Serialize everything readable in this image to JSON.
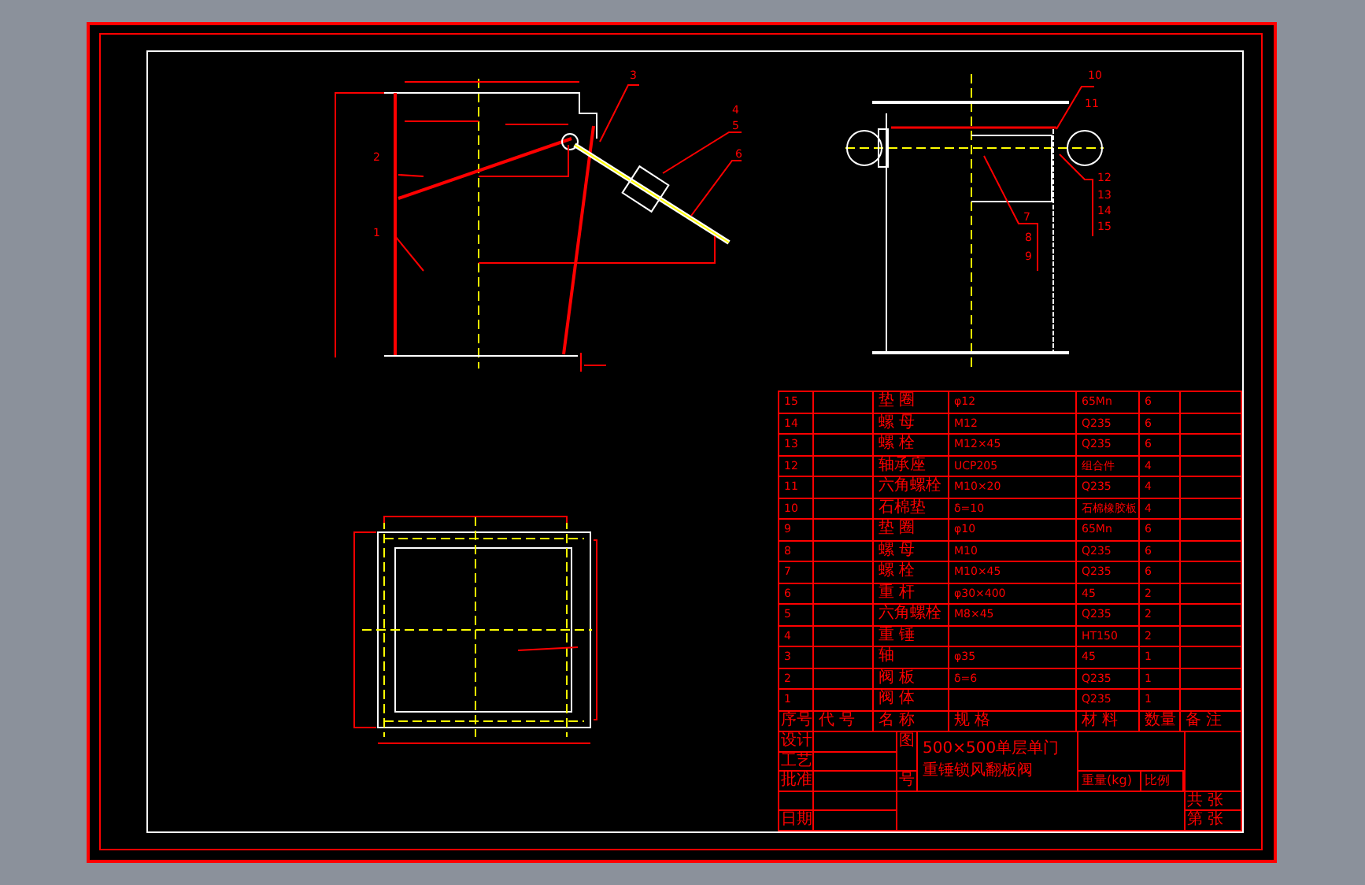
{
  "front_view": {
    "callouts": [
      "1",
      "2",
      "3",
      "4",
      "5",
      "6"
    ]
  },
  "side_view": {
    "callouts": [
      "10",
      "11",
      "12",
      "13",
      "14",
      "15",
      "7",
      "8",
      "9"
    ]
  },
  "parts_table": {
    "columns": [
      "序号",
      "代 号",
      "名 称",
      "规 格",
      "材 料",
      "数量",
      "备 注"
    ],
    "rows": [
      {
        "no": "15",
        "name": "垫 圈",
        "spec": "φ12",
        "material": "65Mn",
        "qty": "6"
      },
      {
        "no": "14",
        "name": "螺 母",
        "spec": "M12",
        "material": "Q235",
        "qty": "6"
      },
      {
        "no": "13",
        "name": "螺 栓",
        "spec": "M12×45",
        "material": "Q235",
        "qty": "6"
      },
      {
        "no": "12",
        "name": "轴承座",
        "spec": "UCP205",
        "material": "组合件",
        "qty": "4"
      },
      {
        "no": "11",
        "name": "六角螺栓",
        "spec": "M10×20",
        "material": "Q235",
        "qty": "4"
      },
      {
        "no": "10",
        "name": "石棉垫",
        "spec": "δ=10",
        "material": "石棉橡胶板",
        "qty": "4"
      },
      {
        "no": "9",
        "name": "垫 圈",
        "spec": "φ10",
        "material": "65Mn",
        "qty": "6"
      },
      {
        "no": "8",
        "name": "螺 母",
        "spec": "M10",
        "material": "Q235",
        "qty": "6"
      },
      {
        "no": "7",
        "name": "螺 栓",
        "spec": "M10×45",
        "material": "Q235",
        "qty": "6"
      },
      {
        "no": "6",
        "name": "重 杆",
        "spec": "φ30×400",
        "material": "45",
        "qty": "2"
      },
      {
        "no": "5",
        "name": "六角螺栓",
        "spec": "M8×45",
        "material": "Q235",
        "qty": "2"
      },
      {
        "no": "4",
        "name": "重 锤",
        "spec": "",
        "material": "HT150",
        "qty": "2"
      },
      {
        "no": "3",
        "name": "轴",
        "spec": "φ35",
        "material": "45",
        "qty": "1"
      },
      {
        "no": "2",
        "name": "阀 板",
        "spec": "δ=6",
        "material": "Q235",
        "qty": "1"
      },
      {
        "no": "1",
        "name": "阀 体",
        "spec": "",
        "material": "Q235",
        "qty": "1"
      }
    ]
  },
  "title_block": {
    "labels": [
      "设计",
      "工艺",
      "批准"
    ],
    "date_label": "日期",
    "drawing_labels": [
      "图",
      "号"
    ],
    "title_lines": [
      "500×500单层单门",
      "重锤锁风翻板阀"
    ],
    "weight_label": "重量(kg)",
    "scale_label": "比例",
    "sheet_total": "共 张",
    "sheet_no": "第 张"
  }
}
